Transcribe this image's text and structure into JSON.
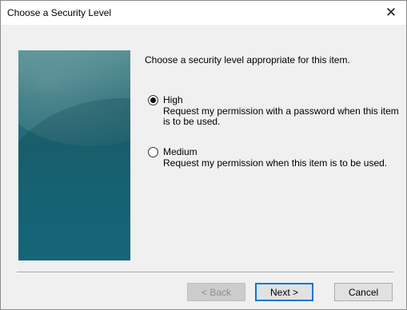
{
  "window": {
    "title": "Choose a Security Level",
    "close_glyph": "✕"
  },
  "content": {
    "prompt": "Choose a security level appropriate for this item.",
    "options": [
      {
        "label": "High",
        "description": "Request my permission with a password when this item is to be used.",
        "selected": true
      },
      {
        "label": "Medium",
        "description": "Request my permission when this item is to be used.",
        "selected": false
      }
    ]
  },
  "buttons": {
    "back": "< Back",
    "next": "Next >",
    "cancel": "Cancel"
  },
  "colors": {
    "banner": "#1f6a78",
    "focus": "#0078d7"
  }
}
